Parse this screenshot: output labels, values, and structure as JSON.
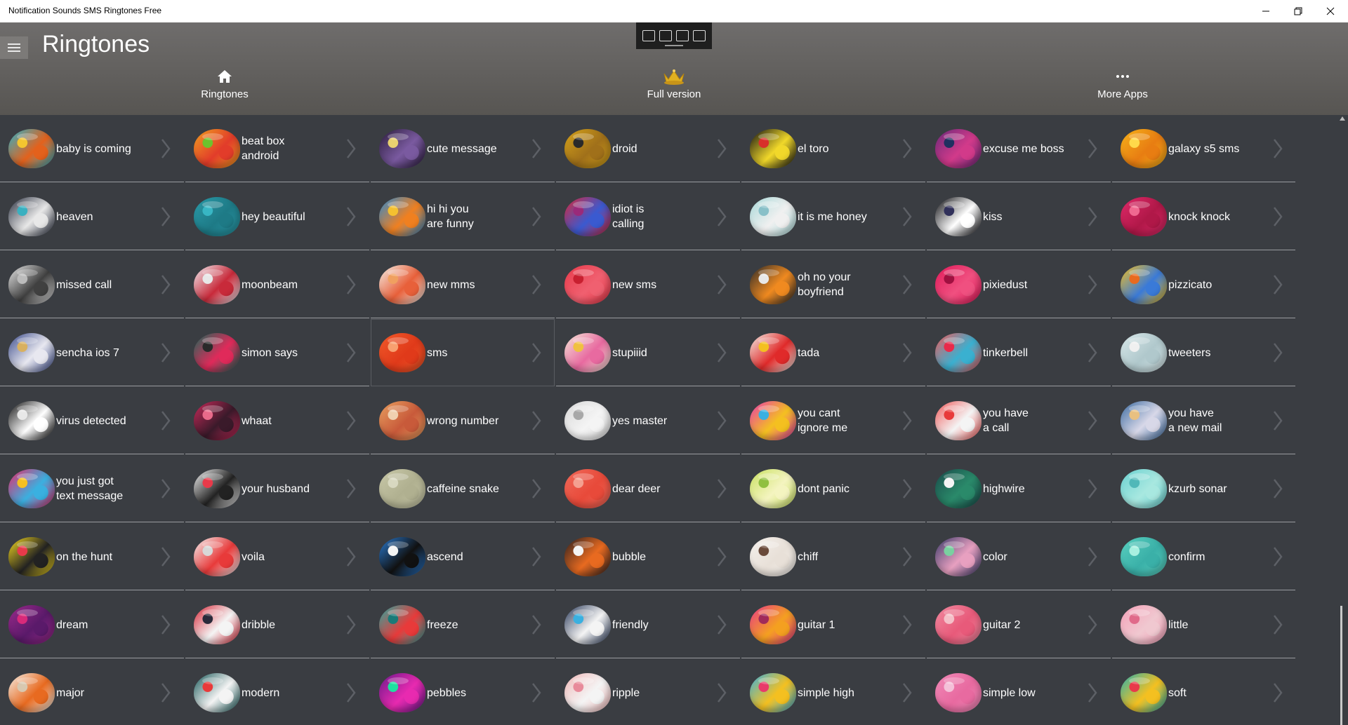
{
  "window": {
    "title": "Notification Sounds SMS Ringtones Free",
    "minimize_icon": "minimize-icon",
    "restore_icon": "restore-icon",
    "close_icon": "close-icon"
  },
  "header": {
    "page_title": "Ringtones",
    "nav": [
      {
        "label": "Ringtones",
        "icon": "home-icon"
      },
      {
        "label": "Full version",
        "icon": "crown-icon"
      },
      {
        "label": "More Apps",
        "icon": "more-dots-icon"
      }
    ]
  },
  "overlay_toolbar": {
    "icons": [
      "select-icon",
      "pointer-icon",
      "frame-icon",
      "inspect-icon"
    ]
  },
  "colors": {
    "background": "#3a3d42",
    "header_top": "#6f6d6c",
    "crown": "#e0b020"
  },
  "ringtones": [
    {
      "label": "baby is coming",
      "colors": [
        "#2fb3c9",
        "#e3611c",
        "#f3c530"
      ]
    },
    {
      "label": "beat box\nandroid",
      "colors": [
        "#f0a020",
        "#e23c2a",
        "#6ec22d"
      ]
    },
    {
      "label": "cute message",
      "colors": [
        "#2a1c3a",
        "#7a5aa0",
        "#e8d070"
      ]
    },
    {
      "label": "droid",
      "colors": [
        "#d4a21b",
        "#a0701a",
        "#2a2a2a"
      ]
    },
    {
      "label": "el toro",
      "colors": [
        "#111111",
        "#f1d82a",
        "#d8302a"
      ]
    },
    {
      "label": "excuse me boss",
      "colors": [
        "#6a2a7a",
        "#d23a8a",
        "#203060"
      ]
    },
    {
      "label": "galaxy s5 sms",
      "colors": [
        "#f5b21a",
        "#e87d12",
        "#ffd94a"
      ]
    },
    {
      "label": "heaven",
      "colors": [
        "#2a3040",
        "#e8e8e8",
        "#3ab0c0"
      ]
    },
    {
      "label": "hey beautiful",
      "colors": [
        "#2a9aa8",
        "#1e7a86",
        "#38b6c4"
      ]
    },
    {
      "label": "hi hi you\nare funny",
      "colors": [
        "#2e8ad0",
        "#f08020",
        "#f4c030"
      ]
    },
    {
      "label": "idiot is\ncalling",
      "colors": [
        "#d8283a",
        "#3a5ad0",
        "#9a2a7a"
      ]
    },
    {
      "label": "it is me honey",
      "colors": [
        "#a8d8d8",
        "#f0f0f0",
        "#88c0c8"
      ]
    },
    {
      "label": "kiss",
      "colors": [
        "#0c0c10",
        "#ffffff",
        "#30305a"
      ]
    },
    {
      "label": "knock knock",
      "colors": [
        "#e02a6a",
        "#b01848",
        "#f06890"
      ]
    },
    {
      "label": "missed call",
      "colors": [
        "#e8e8e8",
        "#404040",
        "#bcbcbc"
      ]
    },
    {
      "label": "moonbeam",
      "colors": [
        "#f0f0f4",
        "#c82a3a",
        "#e8e8e8"
      ]
    },
    {
      "label": "new mms",
      "colors": [
        "#f4f0e8",
        "#e8603a",
        "#f0a060"
      ]
    },
    {
      "label": "new sms",
      "colors": [
        "#e83a4a",
        "#f06070",
        "#c82030"
      ]
    },
    {
      "label": "oh no your\nboyfriend",
      "colors": [
        "#2a2a2a",
        "#f08a20",
        "#e8e8e8"
      ]
    },
    {
      "label": "pixiedust",
      "colors": [
        "#e01a5a",
        "#f05080",
        "#a01040"
      ]
    },
    {
      "label": "pizzicato",
      "colors": [
        "#f4c020",
        "#3a7ad8",
        "#e86a20"
      ]
    },
    {
      "label": "sencha ios 7",
      "colors": [
        "#3a4a8a",
        "#e8e8f0",
        "#d8b060"
      ]
    },
    {
      "label": "simon says",
      "colors": [
        "#1a6a5a",
        "#e02a5a",
        "#2a2a2a"
      ]
    },
    {
      "label": "sms",
      "colors": [
        "#f05a2a",
        "#e03a1a",
        "#f8a070"
      ]
    },
    {
      "label": "stupiiid",
      "colors": [
        "#f4e8d8",
        "#e86aa0",
        "#f0c040"
      ]
    },
    {
      "label": "tada",
      "colors": [
        "#f4f0e8",
        "#e02a2a",
        "#f4c020"
      ]
    },
    {
      "label": "tinkerbell",
      "colors": [
        "#f05a5a",
        "#3ab0d0",
        "#e82a4a"
      ]
    },
    {
      "label": "tweeters",
      "colors": [
        "#d8e8ea",
        "#b0c8cc",
        "#f0f0f0"
      ]
    },
    {
      "label": "virus detected",
      "colors": [
        "#111111",
        "#ffffff",
        "#e8e8e8"
      ]
    },
    {
      "label": "whaat",
      "colors": [
        "#c82a5a",
        "#3a1a2a",
        "#e86a8a"
      ]
    },
    {
      "label": "wrong number",
      "colors": [
        "#e8a060",
        "#c85a3a",
        "#f0d0b0"
      ]
    },
    {
      "label": "yes master",
      "colors": [
        "#d8d8d8",
        "#f4f4f4",
        "#a8a8a8"
      ]
    },
    {
      "label": "you cant\nignore me",
      "colors": [
        "#e83ab0",
        "#f4c020",
        "#3ab0e0"
      ]
    },
    {
      "label": "you have\na call",
      "colors": [
        "#f05a5a",
        "#f4f4f4",
        "#e83a3a"
      ]
    },
    {
      "label": "you have\na new mail",
      "colors": [
        "#3a6aa0",
        "#d8d8e8",
        "#e8c080"
      ]
    },
    {
      "label": "you just got\ntext message",
      "colors": [
        "#e82a6a",
        "#3ab0e0",
        "#f4c020"
      ]
    },
    {
      "label": "your husband",
      "colors": [
        "#f4f4f4",
        "#222222",
        "#e83a4a"
      ]
    },
    {
      "label": "caffeine snake",
      "colors": [
        "#c8c8a8",
        "#b0b090",
        "#d8d8c0"
      ]
    },
    {
      "label": "dear deer",
      "colors": [
        "#f06a5a",
        "#e84a3a",
        "#f4a090"
      ]
    },
    {
      "label": "dont panic",
      "colors": [
        "#c8e060",
        "#f4f4c0",
        "#90c040"
      ]
    },
    {
      "label": "highwire",
      "colors": [
        "#1a4a4a",
        "#2a8a6a",
        "#f4f4f4"
      ]
    },
    {
      "label": "kzurb sonar",
      "colors": [
        "#6ad0d0",
        "#a8e8e0",
        "#50b8b8"
      ]
    },
    {
      "label": "on the hunt",
      "colors": [
        "#f4d820",
        "#222222",
        "#e83a4a"
      ]
    },
    {
      "label": "voila",
      "colors": [
        "#f4f4f4",
        "#e83a3a",
        "#d8d8d8"
      ]
    },
    {
      "label": "ascend",
      "colors": [
        "#2a7ad0",
        "#111111",
        "#f4f4f4"
      ]
    },
    {
      "label": "bubble",
      "colors": [
        "#2a2020",
        "#e86a20",
        "#f4f4f4"
      ]
    },
    {
      "label": "chiff",
      "colors": [
        "#f4f0ec",
        "#e8e0d8",
        "#6a4a3a"
      ]
    },
    {
      "label": "color",
      "colors": [
        "#3a3a6a",
        "#e8a0c0",
        "#7ad0a0"
      ]
    },
    {
      "label": "confirm",
      "colors": [
        "#5ad0c0",
        "#3ab0a8",
        "#a8f0e0"
      ]
    },
    {
      "label": "dream",
      "colors": [
        "#9a2a8a",
        "#5a1a6a",
        "#d82a7a"
      ]
    },
    {
      "label": "dribble",
      "colors": [
        "#d82a3a",
        "#f4f4f4",
        "#2a2a3a"
      ]
    },
    {
      "label": "freeze",
      "colors": [
        "#2aa8a0",
        "#e83a3a",
        "#1a7a78"
      ]
    },
    {
      "label": "friendly",
      "colors": [
        "#2a3a5a",
        "#f4f4f4",
        "#3ab0e0"
      ]
    },
    {
      "label": "guitar 1",
      "colors": [
        "#e83a8a",
        "#f4a020",
        "#a02a5a"
      ]
    },
    {
      "label": "guitar 2",
      "colors": [
        "#f08aa0",
        "#e85a7a",
        "#f4c0c8"
      ]
    },
    {
      "label": "little",
      "colors": [
        "#f4a0b8",
        "#f0c8d0",
        "#e06a8a"
      ]
    },
    {
      "label": "major",
      "colors": [
        "#f4f0e8",
        "#e86a20",
        "#d8c8b0"
      ]
    },
    {
      "label": "modern",
      "colors": [
        "#1a5a5a",
        "#f4f4f4",
        "#e83a3a"
      ]
    },
    {
      "label": "pebbles",
      "colors": [
        "#6a1a8a",
        "#e82ab0",
        "#20e0a0"
      ]
    },
    {
      "label": "ripple",
      "colors": [
        "#f0b8b8",
        "#f4f4f4",
        "#e88a9a"
      ]
    },
    {
      "label": "simple high",
      "colors": [
        "#3ab0e0",
        "#f4c020",
        "#e83a6a"
      ]
    },
    {
      "label": "simple low",
      "colors": [
        "#f08ab8",
        "#e86aa0",
        "#f4c0d8"
      ]
    },
    {
      "label": "soft",
      "colors": [
        "#2ab0b0",
        "#f4c020",
        "#e83a4a"
      ]
    }
  ]
}
